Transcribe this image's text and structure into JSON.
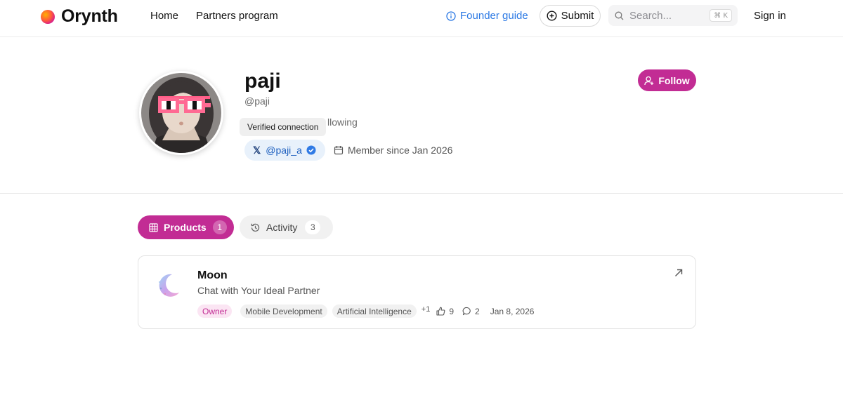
{
  "header": {
    "brand": "Orynth",
    "nav": {
      "home": "Home",
      "partners": "Partners program"
    },
    "founder_guide": "Founder guide",
    "submit": "Submit",
    "search": {
      "placeholder": "Search...",
      "shortcut": "⌘ K"
    },
    "sign_in": "Sign in"
  },
  "profile": {
    "name": "paji",
    "handle": "@paji",
    "following_partial": "llowing",
    "tooltip": "Verified connection",
    "x_handle": "@paji_a",
    "member_since": "Member since Jan 2026",
    "follow_label": "Follow"
  },
  "tabs": [
    {
      "label": "Products",
      "count": "1",
      "active": true
    },
    {
      "label": "Activity",
      "count": "3",
      "active": false
    }
  ],
  "product": {
    "name": "Moon",
    "tagline": "Chat with Your Ideal Partner",
    "role_badge": "Owner",
    "categories": [
      "Mobile Development",
      "Artificial Intelligence"
    ],
    "more_categories": "+1",
    "likes": "9",
    "comments": "2",
    "date": "Jan 8, 2026"
  },
  "colors": {
    "accent": "#c22c94",
    "link_blue": "#2a78e4",
    "verified_blue": "#2f7ae5",
    "chip_bg": "#e8f1fb"
  },
  "icons": {
    "founder_guide": "info-icon",
    "submit": "plus-circle-icon",
    "search": "search-icon",
    "follow": "user-plus-icon",
    "verified": "verified-check-icon",
    "member": "calendar-icon",
    "products_tab": "grid-icon",
    "activity_tab": "history-icon",
    "likes": "thumbs-up-icon",
    "comments": "comment-icon",
    "open": "external-arrow-icon"
  }
}
